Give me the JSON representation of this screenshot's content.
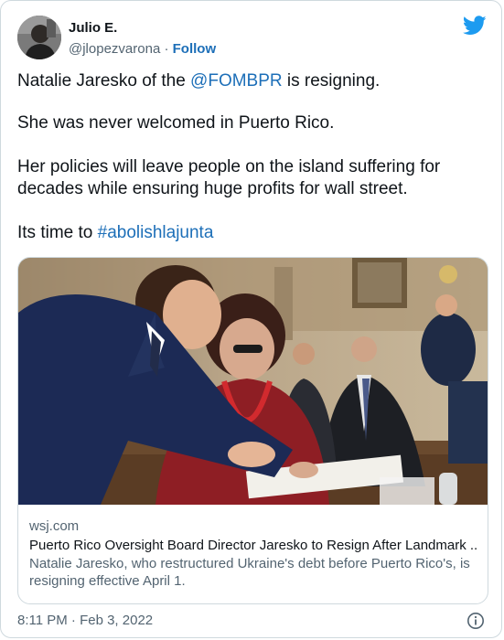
{
  "author": {
    "display_name": "Julio E.",
    "handle": "@jlopezvarona",
    "separator": "·",
    "follow_label": "Follow",
    "avatar_icon": "user-avatar-icon"
  },
  "brand": {
    "logo_icon": "twitter-bird-icon",
    "accent": "#1d9bf0"
  },
  "tweet": {
    "p1_before": "Natalie Jaresko of the ",
    "p1_mention": "@FOMBPR",
    "p1_after": " is resigning.",
    "p2": "She was never welcomed in Puerto Rico.",
    "p3": "Her policies will leave people on the island suffering for decades while ensuring huge profits for wall street.",
    "p4_before": "Its time to ",
    "p4_hashtag": "#abolishlajunta"
  },
  "link_card": {
    "domain": "wsj.com",
    "title": "Puerto Rico Oversight Board Director Jaresko to Resign After Landmark ...",
    "description": "Natalie Jaresko, who restructured Ukraine's debt before Puerto Rico's, is resigning effective April 1."
  },
  "footer": {
    "timestamp": "8:11 PM · Feb 3, 2022",
    "info_icon": "info-icon"
  },
  "colors": {
    "text": "#0f1419",
    "secondary": "#536471",
    "link": "#1d6fb8",
    "border": "#cfd9de"
  }
}
